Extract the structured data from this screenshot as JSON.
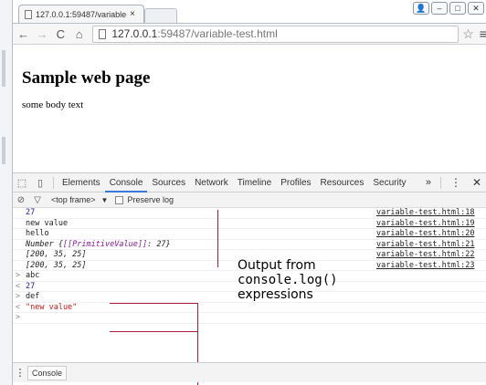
{
  "browser": {
    "tab_title": "127.0.0.1:59487/variable-t",
    "tab_close": "×",
    "url_host": "127.0.0.1",
    "url_rest": ":59487/variable-test.html",
    "nav": {
      "back": "←",
      "forward": "→",
      "reload": "C",
      "home": "⌂"
    },
    "window_buttons": {
      "user": "👤",
      "minimize": "–",
      "maximize": "□",
      "close": "✕"
    },
    "star": "☆",
    "menu": "≡"
  },
  "page": {
    "title": "Sample web page",
    "body": "some body text"
  },
  "devtools": {
    "tabs": [
      "Elements",
      "Console",
      "Sources",
      "Network",
      "Timeline",
      "Profiles",
      "Resources",
      "Security"
    ],
    "active_tab": "Console",
    "more": "»",
    "kebab": "⋮",
    "close": "✕",
    "filter": {
      "context": "<top frame>",
      "dropdown": "▼",
      "preserve_log": "Preserve log"
    },
    "console_output": [
      {
        "text": "27",
        "source": "variable-test.html:18",
        "style": "num"
      },
      {
        "text": "new value",
        "source": "variable-test.html:19",
        "style": "plain"
      },
      {
        "text": "hello",
        "source": "variable-test.html:20",
        "style": "plain"
      },
      {
        "text_prefix": "Number {",
        "text_key": "[[PrimitiveValue]]",
        "text_suffix": ": 27}",
        "source": "variable-test.html:21",
        "style": "italic"
      },
      {
        "text": "[200, 35, 25]",
        "source": "variable-test.html:22",
        "style": "italic"
      },
      {
        "text": "[200, 35, 25]",
        "source": "variable-test.html:23",
        "style": "italic"
      }
    ],
    "console_input": [
      {
        "gutter": ">",
        "text": "abc",
        "style": "input"
      },
      {
        "gutter": "<",
        "text": "27",
        "style": "ret-num"
      },
      {
        "gutter": ">",
        "text": "def",
        "style": "input"
      },
      {
        "gutter": "<",
        "text": "\"new value\"",
        "style": "ret-str"
      },
      {
        "gutter": ">",
        "text": "",
        "style": "input"
      }
    ],
    "drawer_tab": "Console"
  },
  "annotation": {
    "line1": "Output from",
    "line2": "console.log()",
    "line3": "expressions",
    "line_color": "#b11b3a"
  }
}
